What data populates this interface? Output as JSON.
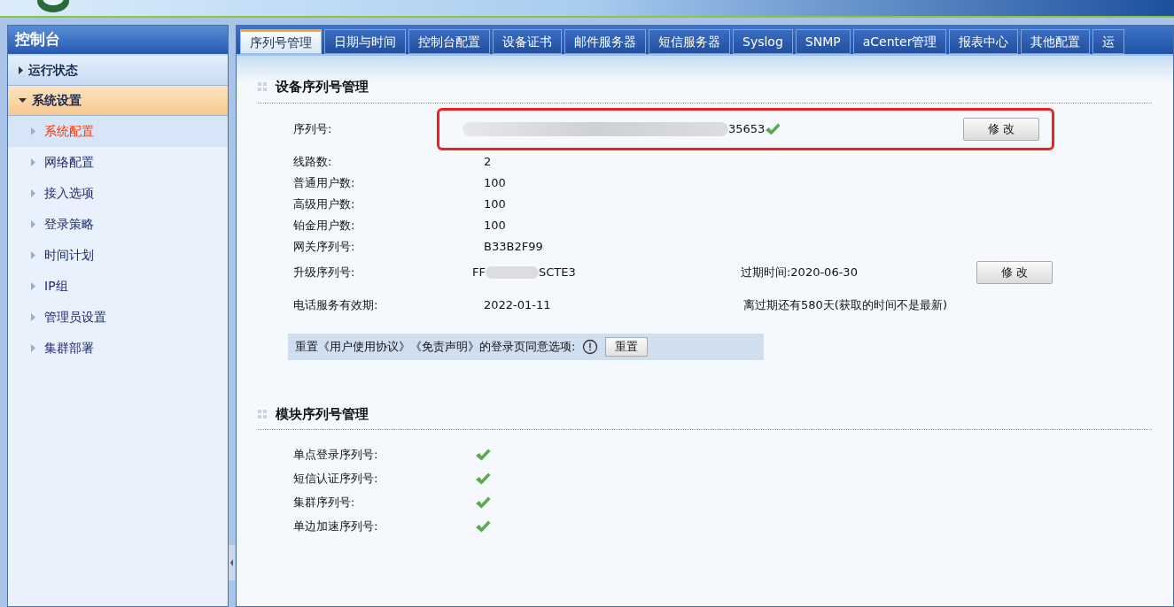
{
  "sidebar": {
    "title": "控制台",
    "sections": [
      {
        "label": "运行状态",
        "expanded": false
      },
      {
        "label": "系统设置",
        "expanded": true,
        "items": [
          {
            "label": "系统配置",
            "selected": true
          },
          {
            "label": "网络配置",
            "selected": false
          },
          {
            "label": "接入选项",
            "selected": false
          },
          {
            "label": "登录策略",
            "selected": false
          },
          {
            "label": "时间计划",
            "selected": false
          },
          {
            "label": "IP组",
            "selected": false
          },
          {
            "label": "管理员设置",
            "selected": false
          },
          {
            "label": "集群部署",
            "selected": false
          }
        ]
      }
    ]
  },
  "tabs": [
    {
      "label": "序列号管理",
      "selected": true
    },
    {
      "label": "日期与时间",
      "selected": false
    },
    {
      "label": "控制台配置",
      "selected": false
    },
    {
      "label": "设备证书",
      "selected": false
    },
    {
      "label": "邮件服务器",
      "selected": false
    },
    {
      "label": "短信服务器",
      "selected": false
    },
    {
      "label": "Syslog",
      "selected": false
    },
    {
      "label": "SNMP",
      "selected": false
    },
    {
      "label": "aCenter管理",
      "selected": false
    },
    {
      "label": "报表中心",
      "selected": false
    },
    {
      "label": "其他配置",
      "selected": false
    },
    {
      "label": "运",
      "selected": false
    }
  ],
  "device_section": {
    "title": "设备序列号管理",
    "serial": {
      "label": "序列号:",
      "value": "35653",
      "valid": true,
      "button": "修 改"
    },
    "rows": [
      {
        "label": "线路数:",
        "value": "2"
      },
      {
        "label": "普通用户数:",
        "value": "100"
      },
      {
        "label": "高级用户数:",
        "value": "100"
      },
      {
        "label": "铂金用户数:",
        "value": "100"
      },
      {
        "label": "网关序列号:",
        "value": "B33B2F99"
      }
    ],
    "upgrade": {
      "label": "升级序列号:",
      "value_start": "FF",
      "value_end": "SCTE3",
      "expiry": "过期时间:2020-06-30",
      "button": "修 改"
    },
    "phone": {
      "label": "电话服务有效期:",
      "value": "2022-01-11",
      "note": "离过期还有580天(获取的时间不是最新)"
    },
    "reset": {
      "label": "重置《用户使用协议》《免责声明》的登录页同意选项:",
      "button": "重置"
    }
  },
  "module_section": {
    "title": "模块序列号管理",
    "rows": [
      {
        "label": "单点登录序列号:",
        "valid": true
      },
      {
        "label": "短信认证序列号:",
        "valid": true
      },
      {
        "label": "集群序列号:",
        "valid": true
      },
      {
        "label": "单边加速序列号:",
        "valid": true
      }
    ]
  }
}
